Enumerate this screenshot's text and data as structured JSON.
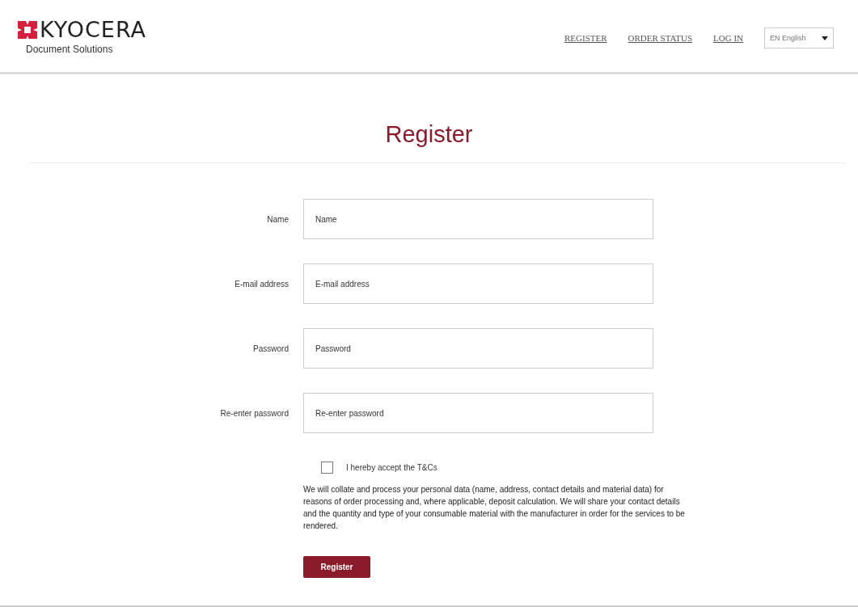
{
  "header": {
    "logo": {
      "brand": "KYOCERA",
      "tagline": "Document Solutions"
    },
    "nav": [
      {
        "label": "REGISTER"
      },
      {
        "label": "ORDER STATUS"
      },
      {
        "label": "LOG IN"
      }
    ],
    "language_select": {
      "value": "EN English"
    }
  },
  "title": "Register",
  "form": {
    "fields": [
      {
        "label": "Name",
        "placeholder": "Name"
      },
      {
        "label": "E-mail address",
        "placeholder": "E-mail address"
      },
      {
        "label": "Password",
        "placeholder": "Password"
      },
      {
        "label": "Re-enter password",
        "placeholder": "Re-enter password"
      }
    ],
    "terms": {
      "label": "I hereby accept the T&Cs",
      "checked": false
    },
    "notice": "We will collate and process your personal data (name, address, contact details and material data) for reasons of order processing and, where applicable, deposit calculation. We will share your contact details and the quantity and type of your consumable material with the manufacturer in order for the services to be rendered.",
    "submit": "Register"
  }
}
